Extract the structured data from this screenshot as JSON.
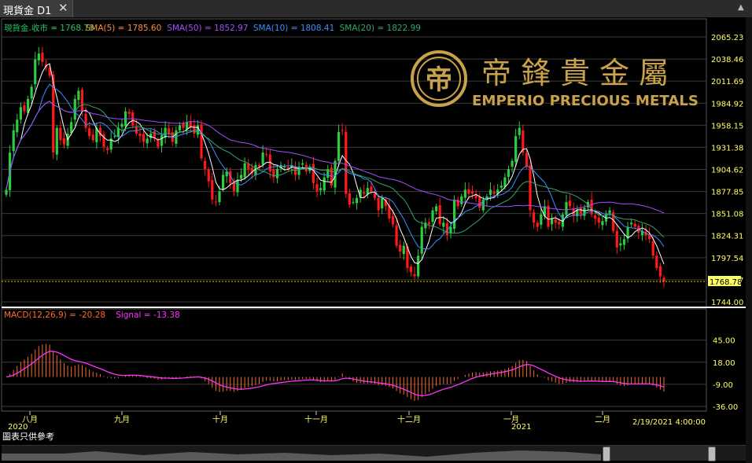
{
  "tab": {
    "title": "現貨金 D1",
    "close_icon": "close-icon"
  },
  "window": {
    "collapse_icon": "chevron-up-icon"
  },
  "logo": {
    "name_cn": "帝鋒貴金屬",
    "name_en": "EMPERIO PRECIOUS METALS",
    "color": "#c9a14a"
  },
  "disclaimer": "圖表只供參考",
  "price_panel": {
    "legend": [
      {
        "text": "現貨金.收市 = 1768.78",
        "color": "#22c55e"
      },
      {
        "text": "SMA(5) = 1785.60",
        "color": "#ff8c3a"
      },
      {
        "text": "SMA(50) = 1852.97",
        "color": "#a24dff"
      },
      {
        "text": "SMA(10) = 1808.41",
        "color": "#3b8fff"
      },
      {
        "text": "SMA(20) = 1822.99",
        "color": "#2fa86b"
      }
    ],
    "current_price_label": "1768.78",
    "up_color": "#2ecc40",
    "down_color": "#ff1a1a"
  },
  "macd_panel": {
    "legend": [
      {
        "text": "MACD(12,26,9) = -20.28",
        "color": "#ff6a2a"
      },
      {
        "text": "Signal = -13.38",
        "color": "#ff33ff"
      }
    ]
  },
  "x_axis": {
    "months": [
      "八月",
      "九月",
      "十月",
      "十一月",
      "十二月",
      "一月",
      "二月"
    ],
    "years": [
      "2020",
      "2021"
    ],
    "end_label": "2/19/2021 4:00:00"
  },
  "chart_data": [
    {
      "type": "candlestick",
      "ylim": [
        1744,
        2065.23
      ],
      "y_ticks": [
        "2065.23",
        "2038.46",
        "2011.69",
        "1984.92",
        "1958.15",
        "1931.38",
        "1904.62",
        "1877.85",
        "1851.08",
        "1824.31",
        "1797.54",
        "1770.77",
        "1744.00"
      ],
      "last_close": 1768.78,
      "series": [
        {
          "name": "SMA(5)",
          "color": "#ffffff",
          "value": 1785.6
        },
        {
          "name": "SMA(10)",
          "color": "#3b8fff",
          "value": 1808.41
        },
        {
          "name": "SMA(20)",
          "color": "#2fa86b",
          "value": 1822.99
        },
        {
          "name": "SMA(50)",
          "color": "#a24dff",
          "value": 1852.97
        }
      ],
      "closes": [
        1880,
        1925,
        1952,
        1965,
        1980,
        1975,
        1990,
        2005,
        2038,
        2045,
        2035,
        2028,
        2018,
        1925,
        1955,
        1940,
        1935,
        1948,
        1962,
        1990,
        2000,
        1975,
        1955,
        1945,
        1940,
        1955,
        1945,
        1932,
        1928,
        1942,
        1945,
        1955,
        1960,
        1975,
        1972,
        1958,
        1948,
        1945,
        1938,
        1942,
        1948,
        1942,
        1932,
        1946,
        1955,
        1948,
        1938,
        1952,
        1958,
        1955,
        1962,
        1955,
        1948,
        1958,
        1918,
        1905,
        1890,
        1868,
        1865,
        1878,
        1898,
        1902,
        1888,
        1878,
        1892,
        1898,
        1912,
        1905,
        1900,
        1910,
        1908,
        1925,
        1922,
        1902,
        1895,
        1905,
        1910,
        1908,
        1905,
        1910,
        1898,
        1908,
        1912,
        1902,
        1908,
        1888,
        1878,
        1882,
        1895,
        1905,
        1885,
        1915,
        1950,
        1952,
        1875,
        1862,
        1865,
        1870,
        1880,
        1875,
        1882,
        1878,
        1870,
        1855,
        1870,
        1860,
        1845,
        1838,
        1812,
        1805,
        1812,
        1785,
        1780,
        1775,
        1800,
        1835,
        1840,
        1838,
        1855,
        1860,
        1838,
        1840,
        1825,
        1835,
        1868,
        1860,
        1872,
        1880,
        1875,
        1875,
        1870,
        1858,
        1868,
        1872,
        1880,
        1875,
        1880,
        1885,
        1895,
        1905,
        1915,
        1945,
        1955,
        1925,
        1908,
        1855,
        1840,
        1835,
        1850,
        1860,
        1835,
        1845,
        1840,
        1838,
        1850,
        1865,
        1860,
        1848,
        1855,
        1850,
        1858,
        1865,
        1850,
        1845,
        1840,
        1842,
        1850,
        1855,
        1830,
        1810,
        1815,
        1820,
        1835,
        1840,
        1835,
        1828,
        1830,
        1825,
        1820,
        1800,
        1785,
        1775,
        1768.78
      ]
    },
    {
      "type": "macd",
      "ylim": [
        -36,
        60
      ],
      "y_ticks": [
        "45.00",
        "18.00",
        "-9.00",
        "-36.00"
      ],
      "macd": -20.28,
      "signal": -13.38
    }
  ]
}
